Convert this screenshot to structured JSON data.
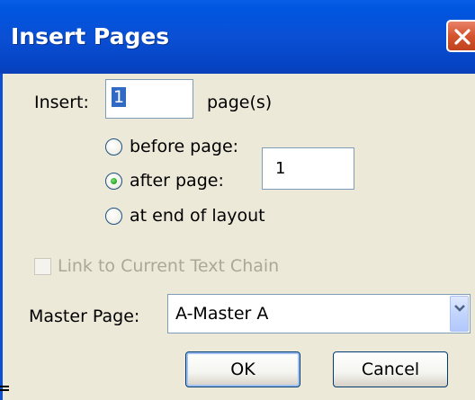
{
  "dialog": {
    "title": "Insert Pages"
  },
  "insert": {
    "label": "Insert:",
    "count_value": "1",
    "unit": "page(s)"
  },
  "position": {
    "options": [
      {
        "label": "before page:",
        "selected": false
      },
      {
        "label": "after page:",
        "selected": true
      },
      {
        "label": "at end of layout",
        "selected": false
      }
    ],
    "page_value": "1"
  },
  "link": {
    "label": "Link to Current Text Chain",
    "checked": false,
    "enabled": false
  },
  "master": {
    "label": "Master Page:",
    "value": "A-Master A"
  },
  "buttons": {
    "ok": "OK",
    "cancel": "Cancel"
  },
  "colors": {
    "titlebar": "#0a4fd4",
    "client": "#ece9d8",
    "close": "#d4542e"
  },
  "icons": {
    "close": "close-icon",
    "dropdown": "chevron-down-icon"
  }
}
